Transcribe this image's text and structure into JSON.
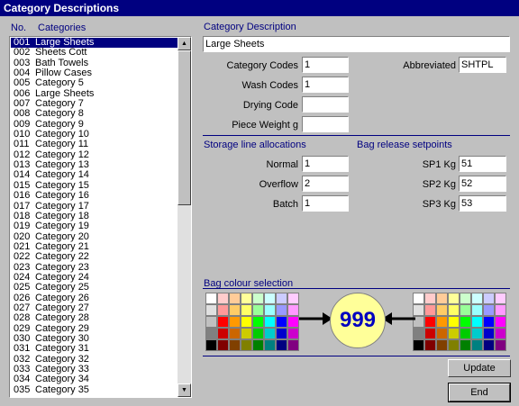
{
  "window": {
    "title": "Category Descriptions"
  },
  "list": {
    "col_no": "No.",
    "col_categories": "Categories",
    "items": [
      {
        "no": "001",
        "name": "Large Sheets",
        "selected": true
      },
      {
        "no": "002",
        "name": "Sheets Cott"
      },
      {
        "no": "003",
        "name": "Bath Towels"
      },
      {
        "no": "004",
        "name": "Pillow Cases"
      },
      {
        "no": "005",
        "name": "Category 5"
      },
      {
        "no": "006",
        "name": "Large Sheets"
      },
      {
        "no": "007",
        "name": "Category 7"
      },
      {
        "no": "008",
        "name": "Category 8"
      },
      {
        "no": "009",
        "name": "Category 9"
      },
      {
        "no": "010",
        "name": "Category 10"
      },
      {
        "no": "011",
        "name": "Category 11"
      },
      {
        "no": "012",
        "name": "Category 12"
      },
      {
        "no": "013",
        "name": "Category 13"
      },
      {
        "no": "014",
        "name": "Category 14"
      },
      {
        "no": "015",
        "name": "Category 15"
      },
      {
        "no": "016",
        "name": "Category 16"
      },
      {
        "no": "017",
        "name": "Category 17"
      },
      {
        "no": "018",
        "name": "Category 18"
      },
      {
        "no": "019",
        "name": "Category 19"
      },
      {
        "no": "020",
        "name": "Category 20"
      },
      {
        "no": "021",
        "name": "Category 21"
      },
      {
        "no": "022",
        "name": "Category 22"
      },
      {
        "no": "023",
        "name": "Category 23"
      },
      {
        "no": "024",
        "name": "Category 24"
      },
      {
        "no": "025",
        "name": "Category 25"
      },
      {
        "no": "026",
        "name": "Category 26"
      },
      {
        "no": "027",
        "name": "Category 27"
      },
      {
        "no": "028",
        "name": "Category 28"
      },
      {
        "no": "029",
        "name": "Category 29"
      },
      {
        "no": "030",
        "name": "Category 30"
      },
      {
        "no": "031",
        "name": "Category 31"
      },
      {
        "no": "032",
        "name": "Category 32"
      },
      {
        "no": "033",
        "name": "Category 33"
      },
      {
        "no": "034",
        "name": "Category 34"
      },
      {
        "no": "035",
        "name": "Category 35"
      }
    ]
  },
  "desc": {
    "heading": "Category Description",
    "value": "Large Sheets",
    "category_codes_label": "Category Codes",
    "category_codes_value": "1",
    "wash_codes_label": "Wash Codes",
    "wash_codes_value": "1",
    "drying_code_label": "Drying Code",
    "drying_code_value": "",
    "piece_weight_label": "Piece Weight g",
    "piece_weight_value": "",
    "abbreviated_label": "Abbreviated",
    "abbreviated_value": "SHTPL"
  },
  "storage": {
    "heading": "Storage line allocations",
    "normal_label": "Normal",
    "normal_value": "1",
    "overflow_label": "Overflow",
    "overflow_value": "2",
    "batch_label": "Batch",
    "batch_value": "1"
  },
  "setpoints": {
    "heading": "Bag release setpoints",
    "sp1_label": "SP1 Kg",
    "sp1_value": "51",
    "sp2_label": "SP2 Kg",
    "sp2_value": "52",
    "sp3_label": "SP3 Kg",
    "sp3_value": "53"
  },
  "bag_colour": {
    "heading": "Bag colour selection",
    "display_value": "999",
    "circle_color": "#ffff99",
    "text_color": "#0000c0",
    "palette": [
      "#ffffff",
      "#ffcccc",
      "#ffcc99",
      "#ffff99",
      "#ccffcc",
      "#ccffff",
      "#ccccff",
      "#ffccff",
      "#e0e0e0",
      "#ff9999",
      "#ffcc66",
      "#ffff66",
      "#99ff99",
      "#99ffff",
      "#9999ff",
      "#ff99ff",
      "#c0c0c0",
      "#ff0000",
      "#ff9900",
      "#ffff00",
      "#00ff00",
      "#00ffff",
      "#0000ff",
      "#ff00ff",
      "#808080",
      "#cc0000",
      "#cc6600",
      "#cccc00",
      "#00cc00",
      "#00cccc",
      "#0000cc",
      "#cc00cc",
      "#000000",
      "#800000",
      "#804000",
      "#808000",
      "#008000",
      "#008080",
      "#000080",
      "#800080"
    ]
  },
  "buttons": {
    "update": "Update",
    "end": "End"
  }
}
